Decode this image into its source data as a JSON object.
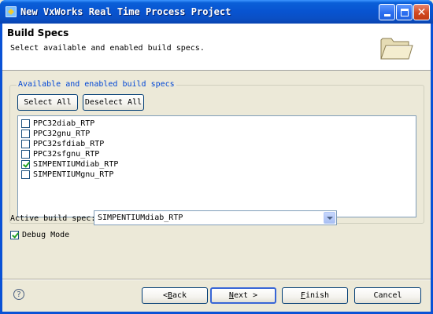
{
  "window": {
    "title": "New VxWorks Real Time Process Project"
  },
  "header": {
    "title": "Build Specs",
    "description": "Select available and enabled build specs."
  },
  "group": {
    "label": "Available and enabled build specs",
    "select_all": "Select All",
    "deselect_all": "Deselect All",
    "items": [
      {
        "label": "PPC32diab_RTP",
        "checked": false
      },
      {
        "label": "PPC32gnu_RTP",
        "checked": false
      },
      {
        "label": "PPC32sfdiab_RTP",
        "checked": false
      },
      {
        "label": "PPC32sfgnu_RTP",
        "checked": false
      },
      {
        "label": "SIMPENTIUMdiab_RTP",
        "checked": true
      },
      {
        "label": "SIMPENTIUMgnu_RTP",
        "checked": false
      }
    ]
  },
  "active_spec": {
    "label": "Active build spec:",
    "value": "SIMPENTIUMdiab_RTP"
  },
  "debug": {
    "label": "Debug Mode",
    "checked": true
  },
  "footer": {
    "help": "?",
    "back_prefix": "< ",
    "back_key": "B",
    "back_rest": "ack",
    "next_key": "N",
    "next_rest": "ext >",
    "finish_key": "F",
    "finish_rest": "inish",
    "cancel": "Cancel"
  }
}
